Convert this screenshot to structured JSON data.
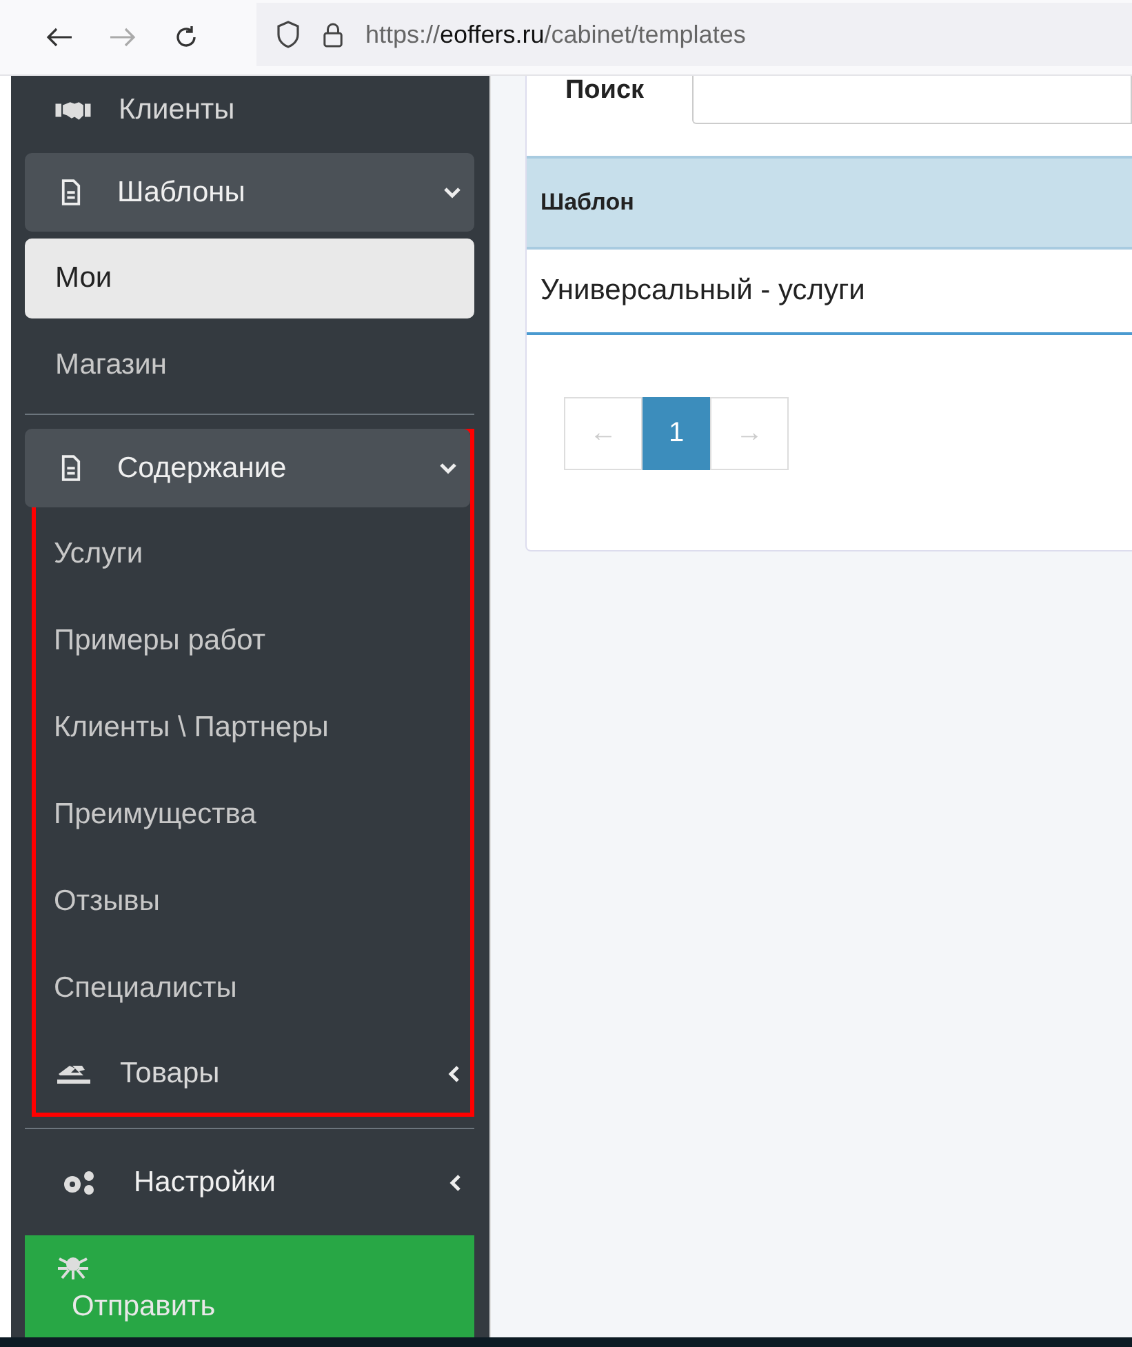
{
  "browser": {
    "back_disabled": false,
    "forward_disabled": true,
    "url_scheme": "https://",
    "url_host": "eoffers.ru",
    "url_path": "/cabinet/templates"
  },
  "sidebar": {
    "items": [
      {
        "kind": "link",
        "label": "Клиенты"
      },
      {
        "kind": "group",
        "label": "Шаблоны",
        "expanded": true,
        "highlighted": false,
        "children": [
          {
            "label": "Мои",
            "selected": true
          },
          {
            "label": "Магазин",
            "selected": false
          }
        ]
      },
      {
        "kind": "divider"
      },
      {
        "kind": "group",
        "label": "Содержание",
        "expanded": true,
        "highlighted": true,
        "children": [
          {
            "label": "Услуги",
            "selected": false
          },
          {
            "label": "Примеры работ",
            "selected": false
          },
          {
            "label": "Клиенты \\ Партнеры",
            "selected": false
          },
          {
            "label": "Преимущества",
            "selected": false
          },
          {
            "label": "Отзывы",
            "selected": false
          },
          {
            "label": "Специалисты",
            "selected": false
          },
          {
            "kind": "group",
            "label": "Товары",
            "expanded": false
          }
        ]
      },
      {
        "kind": "divider"
      },
      {
        "kind": "group",
        "label": "Настройки",
        "expanded": false,
        "highlighted": false
      }
    ],
    "send_button": "Отправить"
  },
  "search": {
    "label": "Поиск"
  },
  "table": {
    "columns": [
      "Шаблон"
    ],
    "rows": [
      [
        "Универсальный - услуги"
      ]
    ]
  },
  "pagination": [
    {
      "label": "←",
      "disabled": true,
      "selected": false
    },
    {
      "label": "1",
      "disabled": false,
      "selected": true
    },
    {
      "label": "→",
      "disabled": true,
      "selected": false
    }
  ]
}
